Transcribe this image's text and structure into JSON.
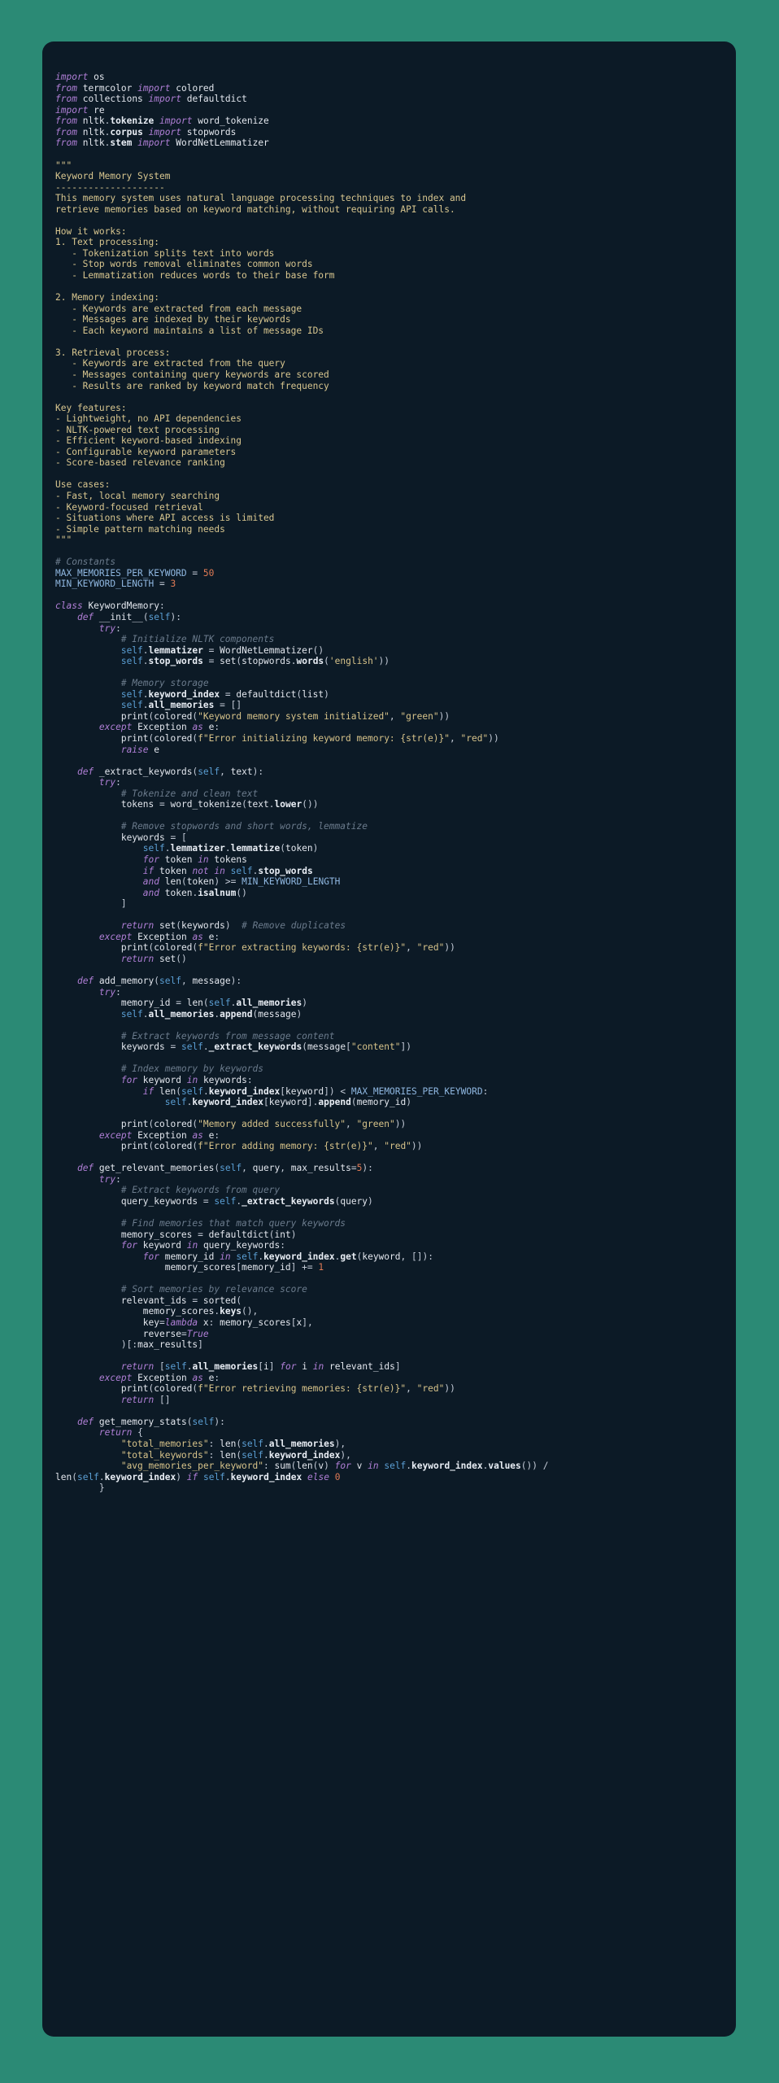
{
  "window": {
    "background_color": "#2b8a75",
    "card_background_color": "#0c1a26",
    "language": "python"
  },
  "theme": {
    "keyword": "#b07fd6",
    "string": "#d7c38a",
    "docstring": "#d8c68f",
    "comment": "#6b7b8c",
    "number": "#e07a55",
    "self": "#5b9fd4",
    "constant": "#8fb7e0",
    "text": "#e3e7ee",
    "bold_attribute": "#e8edf4"
  },
  "code": {
    "title": "Keyword Memory System",
    "lines": [
      "import os",
      "from termcolor import colored",
      "from collections import defaultdict",
      "import re",
      "from nltk.tokenize import word_tokenize",
      "from nltk.corpus import stopwords",
      "from nltk.stem import WordNetLemmatizer",
      "",
      "\"\"\"",
      "Keyword Memory System",
      "--------------------",
      "This memory system uses natural language processing techniques to index and",
      "retrieve memories based on keyword matching, without requiring API calls.",
      "",
      "How it works:",
      "1. Text processing:",
      "   - Tokenization splits text into words",
      "   - Stop words removal eliminates common words",
      "   - Lemmatization reduces words to their base form",
      "",
      "2. Memory indexing:",
      "   - Keywords are extracted from each message",
      "   - Messages are indexed by their keywords",
      "   - Each keyword maintains a list of message IDs",
      "",
      "3. Retrieval process:",
      "   - Keywords are extracted from the query",
      "   - Messages containing query keywords are scored",
      "   - Results are ranked by keyword match frequency",
      "",
      "Key features:",
      "- Lightweight, no API dependencies",
      "- NLTK-powered text processing",
      "- Efficient keyword-based indexing",
      "- Configurable keyword parameters",
      "- Score-based relevance ranking",
      "",
      "Use cases:",
      "- Fast, local memory searching",
      "- Keyword-focused retrieval",
      "- Situations where API access is limited",
      "- Simple pattern matching needs",
      "\"\"\"",
      "",
      "# Constants",
      "MAX_MEMORIES_PER_KEYWORD = 50",
      "MIN_KEYWORD_LENGTH = 3",
      "",
      "class KeywordMemory:",
      "    def __init__(self):",
      "        try:",
      "            # Initialize NLTK components",
      "            self.lemmatizer = WordNetLemmatizer()",
      "            self.stop_words = set(stopwords.words('english'))",
      "",
      "            # Memory storage",
      "            self.keyword_index = defaultdict(list)",
      "            self.all_memories = []",
      "            print(colored(\"Keyword memory system initialized\", \"green\"))",
      "        except Exception as e:",
      "            print(colored(f\"Error initializing keyword memory: {str(e)}\", \"red\"))",
      "            raise e",
      "",
      "    def _extract_keywords(self, text):",
      "        try:",
      "            # Tokenize and clean text",
      "            tokens = word_tokenize(text.lower())",
      "",
      "            # Remove stopwords and short words, lemmatize",
      "            keywords = [",
      "                self.lemmatizer.lemmatize(token)",
      "                for token in tokens",
      "                if token not in self.stop_words",
      "                and len(token) >= MIN_KEYWORD_LENGTH",
      "                and token.isalnum()",
      "            ]",
      "",
      "            return set(keywords)  # Remove duplicates",
      "        except Exception as e:",
      "            print(colored(f\"Error extracting keywords: {str(e)}\", \"red\"))",
      "            return set()",
      "",
      "    def add_memory(self, message):",
      "        try:",
      "            memory_id = len(self.all_memories)",
      "            self.all_memories.append(message)",
      "",
      "            # Extract keywords from message content",
      "            keywords = self._extract_keywords(message[\"content\"])",
      "",
      "            # Index memory by keywords",
      "            for keyword in keywords:",
      "                if len(self.keyword_index[keyword]) < MAX_MEMORIES_PER_KEYWORD:",
      "                    self.keyword_index[keyword].append(memory_id)",
      "",
      "            print(colored(\"Memory added successfully\", \"green\"))",
      "        except Exception as e:",
      "            print(colored(f\"Error adding memory: {str(e)}\", \"red\"))",
      "",
      "    def get_relevant_memories(self, query, max_results=5):",
      "        try:",
      "            # Extract keywords from query",
      "            query_keywords = self._extract_keywords(query)",
      "",
      "            # Find memories that match query keywords",
      "            memory_scores = defaultdict(int)",
      "            for keyword in query_keywords:",
      "                for memory_id in self.keyword_index.get(keyword, []):",
      "                    memory_scores[memory_id] += 1",
      "",
      "            # Sort memories by relevance score",
      "            relevant_ids = sorted(",
      "                memory_scores.keys(),",
      "                key=lambda x: memory_scores[x],",
      "                reverse=True",
      "            )[:max_results]",
      "",
      "            return [self.all_memories[i] for i in relevant_ids]",
      "        except Exception as e:",
      "            print(colored(f\"Error retrieving memories: {str(e)}\", \"red\"))",
      "            return []",
      "",
      "    def get_memory_stats(self):",
      "        return {",
      "            \"total_memories\": len(self.all_memories),",
      "            \"total_keywords\": len(self.keyword_index),",
      "            \"avg_memories_per_keyword\": sum(len(v) for v in self.keyword_index.values()) /",
      "len(self.keyword_index) if self.keyword_index else 0",
      "        }"
    ]
  }
}
